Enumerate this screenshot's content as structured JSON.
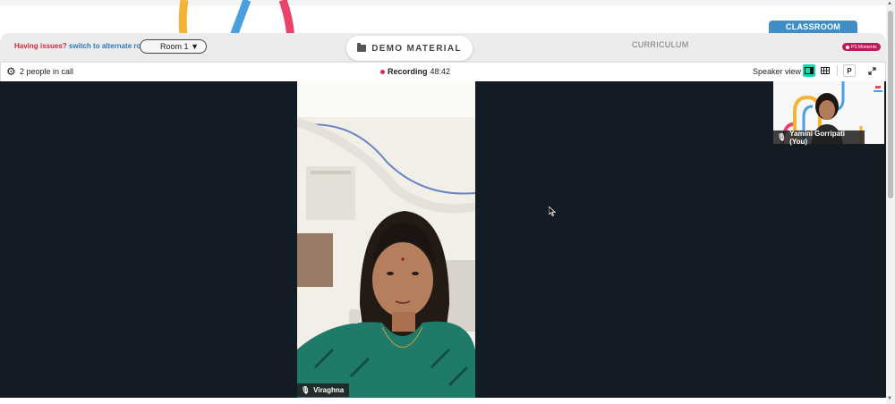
{
  "header": {
    "issues_text": "Having issues?",
    "alt_room_link": "switch to alternate room",
    "room_select_value": "Room 1",
    "demo_material_label": "DEMO MATERIAL",
    "curriculum_tab": "CURRICULUM",
    "classroom_tab": "CLASSROOM",
    "moments_badge": "PS Moments"
  },
  "call_bar": {
    "people_count_text": "2 people in call",
    "recording_label": "Recording",
    "recording_time": "48:42",
    "view_mode_label": "Speaker view",
    "presenter_button": "P"
  },
  "participants": {
    "main_speaker": "Viraghna",
    "self_name": "Yamini Gorripati (You)"
  },
  "colors": {
    "accent_teal": "#22d3b3",
    "classroom_blue": "#3f8ec8",
    "recording_red": "#d62b4b",
    "issues_red": "#d1293d",
    "link_blue": "#2d7ab8",
    "moments_pink": "#c2185b",
    "stage_dark": "#131b24"
  },
  "icons": [
    "gear-icon",
    "folder-icon",
    "recording-dot-icon",
    "speaker-layout-icon",
    "grid-layout-icon",
    "fullscreen-icon",
    "mic-icon",
    "mouse-cursor-icon"
  ]
}
